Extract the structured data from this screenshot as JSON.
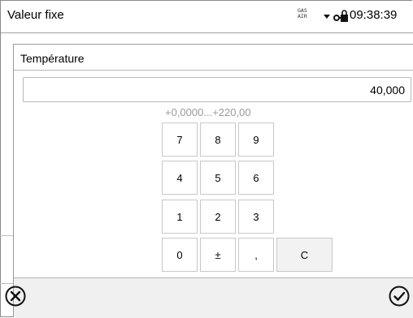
{
  "window": {
    "title": "Valeur fixe",
    "gas_air_top": "GAS",
    "gas_air_bottom": "AIR",
    "time": "09:38:39"
  },
  "dialog": {
    "title": "Température",
    "value": "40,000",
    "range": "+0,0000...+220,00"
  },
  "keypad": {
    "k7": "7",
    "k8": "8",
    "k9": "9",
    "k4": "4",
    "k5": "5",
    "k6": "6",
    "k1": "1",
    "k2": "2",
    "k3": "3",
    "k0": "0",
    "kpm": "±",
    "kcomma": ",",
    "kc": "C"
  },
  "icons": {
    "cancel": "cancel-circle-x-icon",
    "confirm": "confirm-circle-check-icon",
    "dropdown": "triangle-down-icon",
    "lock": "key-lock-icon"
  }
}
